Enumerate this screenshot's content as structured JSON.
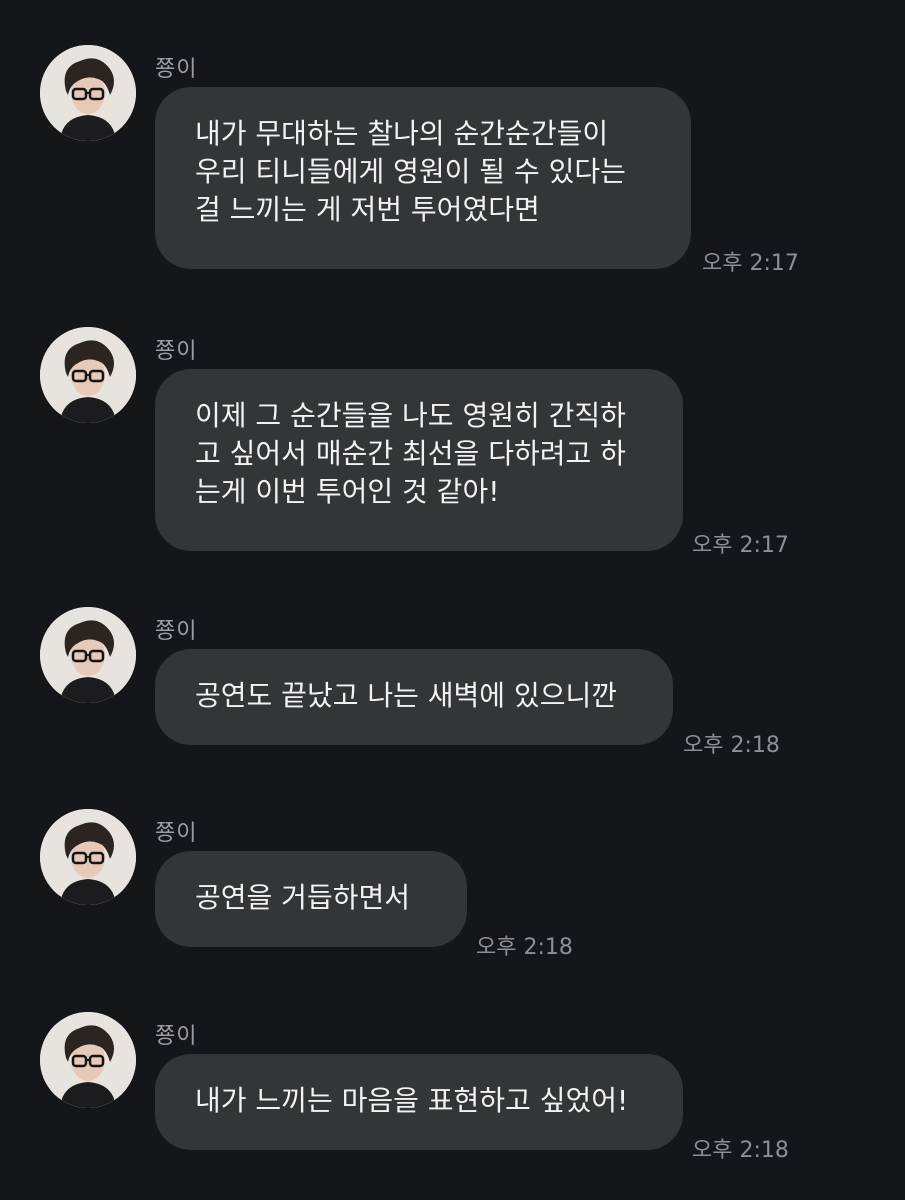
{
  "messages": [
    {
      "sender": "쭁이",
      "text": "내가 무대하는 찰나의 순간순간들이\n우리 티니들에게 영원이 될 수 있다는\n걸 느끼는 게 저번 투어였다면",
      "time": "오후 2:17"
    },
    {
      "sender": "쭁이",
      "text": "이제 그 순간들을 나도 영원히 간직하\n고 싶어서 매순간 최선을 다하려고 하\n는게 이번 투어인 것 같아!",
      "time": "오후 2:17"
    },
    {
      "sender": "쭁이",
      "text": "공연도 끝났고 나는 새벽에 있으니깐",
      "time": "오후 2:18"
    },
    {
      "sender": "쭁이",
      "text": "공연을 거듭하면서",
      "time": "오후 2:18"
    },
    {
      "sender": "쭁이",
      "text": "내가 느끼는 마음을 표현하고 싶었어!",
      "time": "오후 2:18"
    }
  ]
}
